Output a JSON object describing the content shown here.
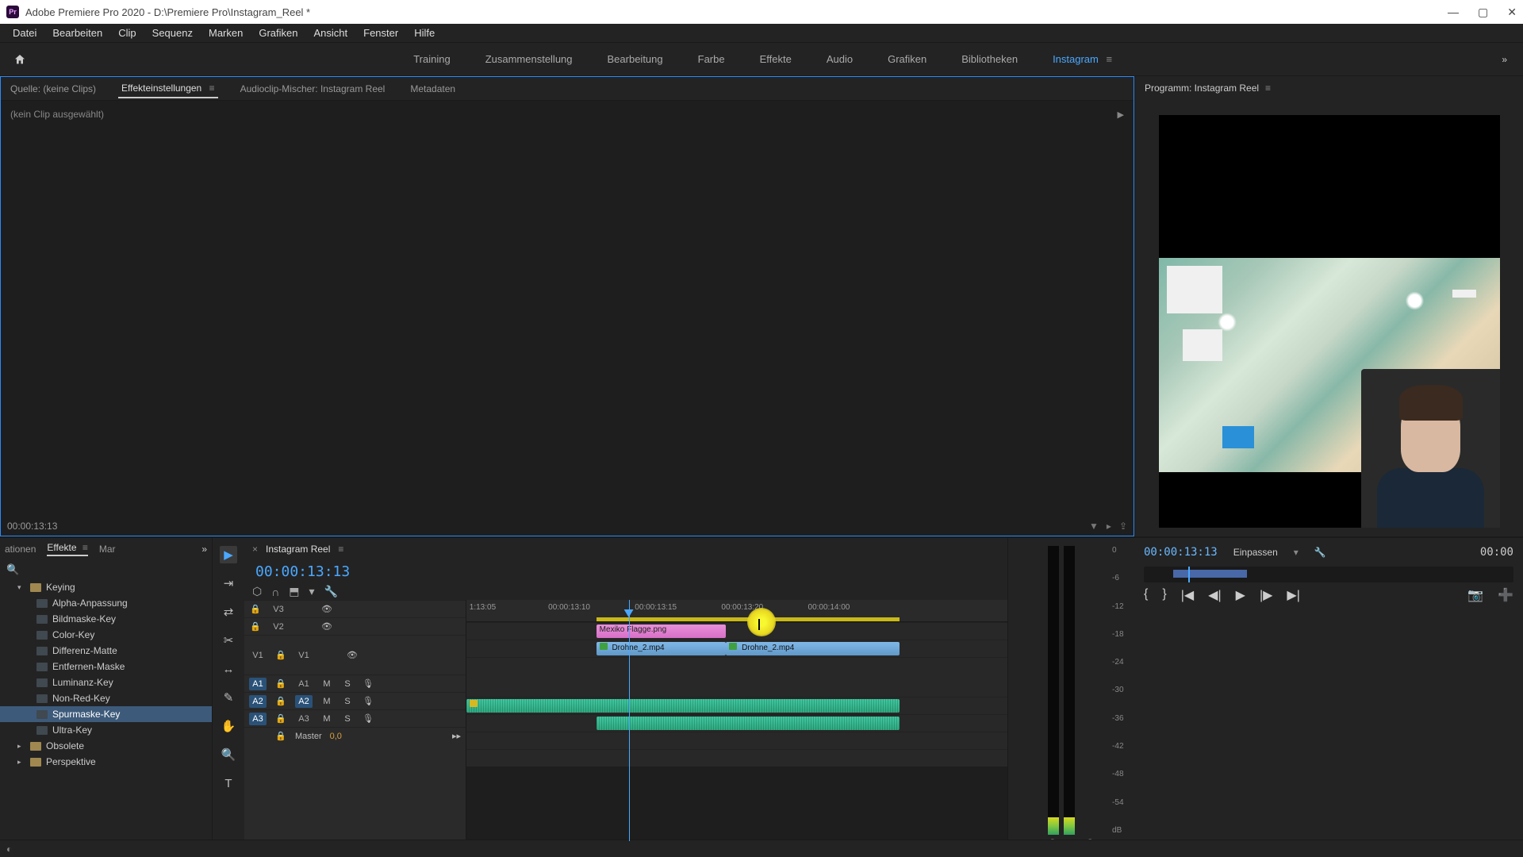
{
  "titlebar": {
    "app_icon_text": "Pr",
    "title": "Adobe Premiere Pro 2020 - D:\\Premiere Pro\\Instagram_Reel *"
  },
  "menu": [
    "Datei",
    "Bearbeiten",
    "Clip",
    "Sequenz",
    "Marken",
    "Grafiken",
    "Ansicht",
    "Fenster",
    "Hilfe"
  ],
  "workspaces": {
    "items": [
      "Training",
      "Zusammenstellung",
      "Bearbeitung",
      "Farbe",
      "Effekte",
      "Audio",
      "Grafiken",
      "Bibliotheken",
      "Instagram"
    ],
    "active": "Instagram"
  },
  "source_panel": {
    "tabs": {
      "source": "Quelle: (keine Clips)",
      "effect": "Effekteinstellungen",
      "mixer": "Audioclip-Mischer: Instagram Reel",
      "metadata": "Metadaten"
    },
    "content_header": "(kein Clip ausgewählt)",
    "footer_tc": "00:00:13:13"
  },
  "program_panel": {
    "title": "Programm: Instagram Reel",
    "tc_left": "00:00:13:13",
    "tc_right": "00:00",
    "fit": "Einpassen"
  },
  "effects": {
    "tabs": {
      "left": "ationen",
      "center": "Effekte",
      "right": "Mar"
    },
    "folder_keying": "Keying",
    "items": [
      "Alpha-Anpassung",
      "Bildmaske-Key",
      "Color-Key",
      "Differenz-Matte",
      "Entfernen-Maske",
      "Luminanz-Key",
      "Non-Red-Key",
      "Spurmaske-Key",
      "Ultra-Key"
    ],
    "selected": "Spurmaske-Key",
    "folder_obsolete": "Obsolete",
    "folder_perspective": "Perspektive"
  },
  "timeline": {
    "seq_name": "Instagram Reel",
    "tc": "00:00:13:13",
    "ruler_ticks": [
      {
        "pos_pct": 3,
        "label": "1:13:05"
      },
      {
        "pos_pct": 19,
        "label": "00:00:13:10"
      },
      {
        "pos_pct": 35,
        "label": "00:00:13:15"
      },
      {
        "pos_pct": 51,
        "label": "00:00:13:20"
      },
      {
        "pos_pct": 67,
        "label": "00:00:14:00"
      }
    ],
    "range": {
      "left_pct": 24,
      "width_pct": 56
    },
    "playhead_pct": 30,
    "cursor_pct": 54.5,
    "tracks": {
      "v3": "V3",
      "v2": "V2",
      "v1": "V1",
      "a1": "A1",
      "a2": "A2",
      "a3": "A3",
      "src_v1": "V1",
      "src_a1": "A1",
      "src_a2": "A2",
      "src_a3": "A3",
      "master": "Master",
      "master_val": "0,0"
    },
    "clips": {
      "flag": "Mexiko Flagge.png",
      "v2a": "Drohne_2.mp4",
      "v2b": "Drohne_2.mp4"
    },
    "lock": "🔒",
    "eye": "👁",
    "mute": "M",
    "solo": "S",
    "mic": "🎙"
  },
  "meters": {
    "scale": [
      "0",
      "-6",
      "-12",
      "-18",
      "-24",
      "-30",
      "-36",
      "-42",
      "-48",
      "-54",
      "dB"
    ],
    "label": "S"
  }
}
